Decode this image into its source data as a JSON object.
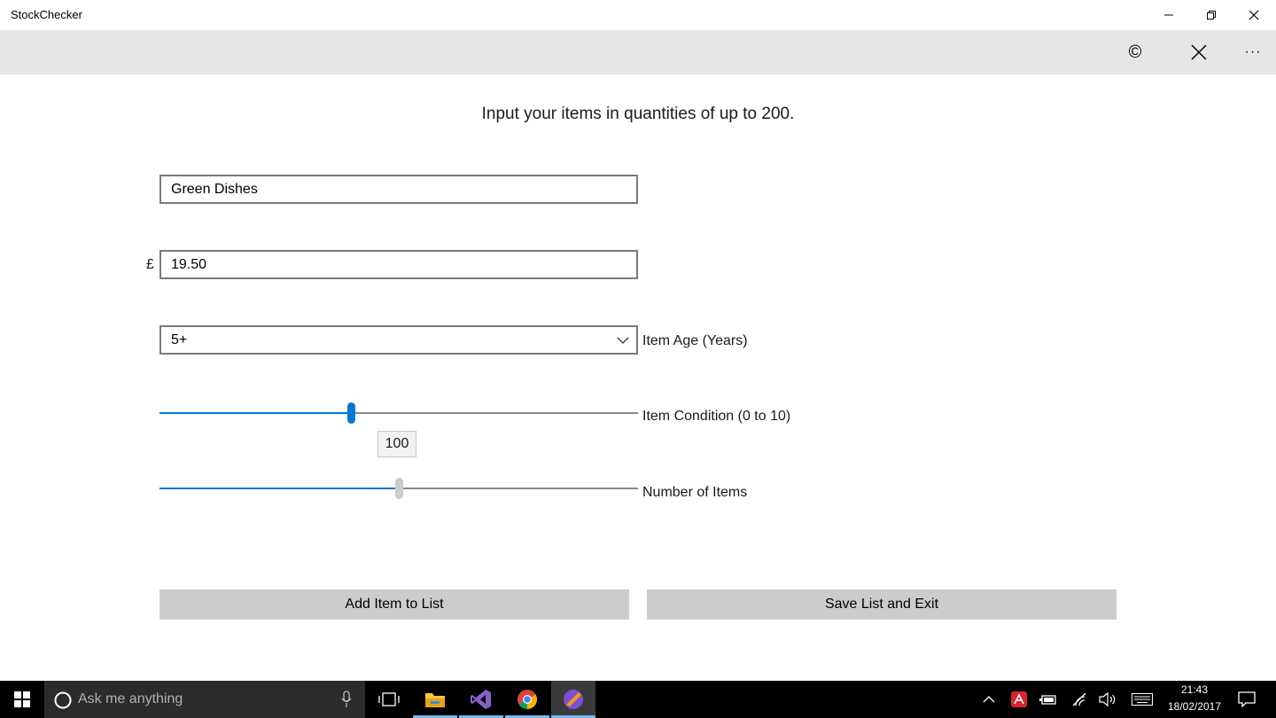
{
  "window": {
    "title": "StockChecker",
    "minimize_glyph": "—",
    "restore_glyph": "❐",
    "close_glyph": "✕"
  },
  "command_bar": {
    "copyright_glyph": "©",
    "close_glyph": "✕",
    "more_glyph": "···"
  },
  "form": {
    "instruction": "Input your items in quantities of up to 200.",
    "item_name": "Green Dishes",
    "currency_symbol": "£",
    "price": "19.50",
    "age_selected": "5+",
    "age_label": "Item Age (Years)",
    "condition_label": "Item Condition (0 to 10)",
    "condition_value": 4,
    "condition_max": 10,
    "quantity_value": 100,
    "quantity_max": 200,
    "quantity_tooltip": "100",
    "quantity_label": "Number of Items"
  },
  "buttons": {
    "add_item": "Add Item to List",
    "save_exit": "Save List and Exit"
  },
  "taskbar": {
    "search_placeholder": "Ask me anything",
    "time": "21:43",
    "date": "18/02/2017"
  },
  "colors": {
    "accent": "#0078d7",
    "command_bar": "#e6e6e6",
    "button": "#cccccc",
    "taskbar": "#000000"
  }
}
